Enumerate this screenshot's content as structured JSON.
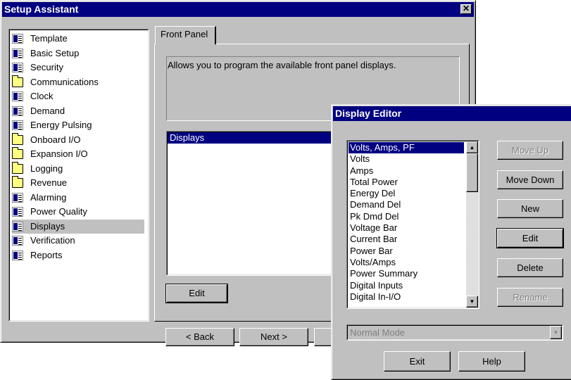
{
  "setup": {
    "title": "Setup Assistant",
    "close_glyph": "✕",
    "tree": [
      {
        "label": "Template",
        "icon": "document-icon"
      },
      {
        "label": "Basic Setup",
        "icon": "document-icon"
      },
      {
        "label": "Security",
        "icon": "document-icon"
      },
      {
        "label": "Communications",
        "icon": "folder-icon"
      },
      {
        "label": "Clock",
        "icon": "document-icon"
      },
      {
        "label": "Demand",
        "icon": "document-icon"
      },
      {
        "label": "Energy Pulsing",
        "icon": "document-icon"
      },
      {
        "label": "Onboard I/O",
        "icon": "folder-icon"
      },
      {
        "label": "Expansion I/O",
        "icon": "folder-icon"
      },
      {
        "label": "Logging",
        "icon": "folder-icon"
      },
      {
        "label": "Revenue",
        "icon": "folder-icon"
      },
      {
        "label": "Alarming",
        "icon": "document-icon"
      },
      {
        "label": "Power Quality",
        "icon": "document-icon"
      },
      {
        "label": "Displays",
        "icon": "document-icon"
      },
      {
        "label": "Verification",
        "icon": "document-icon"
      },
      {
        "label": "Reports",
        "icon": "document-icon"
      }
    ],
    "selected_tree_item": "Displays",
    "tab_label": "Front Panel",
    "description": "Allows you to program the available front panel displays.",
    "list_header": "Displays",
    "edit_label": "Edit",
    "back_label": "< Back",
    "next_label": "Next >"
  },
  "editor": {
    "title": "Display Editor",
    "items": [
      "Volts, Amps, PF",
      "Volts",
      "Amps",
      "Total Power",
      "Energy Del",
      "Demand Del",
      "Pk Dmd Del",
      "Voltage Bar",
      "Current Bar",
      "Power Bar",
      "Volts/Amps",
      "Power Summary",
      "Digital Inputs",
      "Digital In-I/O"
    ],
    "selected_item": "Volts, Amps, PF",
    "buttons": {
      "move_up": "Move Up",
      "move_down": "Move Down",
      "new": "New",
      "edit": "Edit",
      "delete": "Delete",
      "rename": "Rename"
    },
    "mode_value": "Normal Mode",
    "exit_label": "Exit",
    "help_label": "Help"
  }
}
